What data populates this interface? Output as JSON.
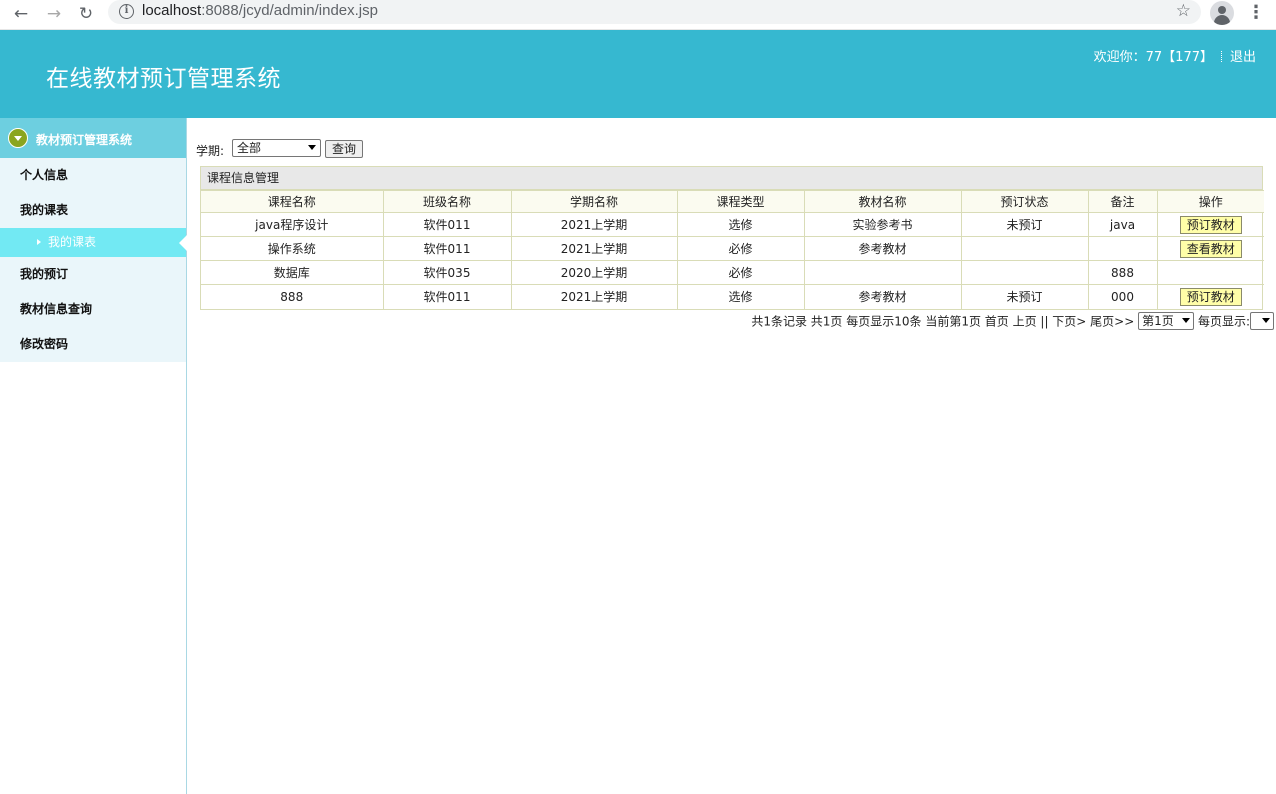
{
  "browser": {
    "url_host": "localhost",
    "url_rest": ":8088/jcyd/admin/index.jsp"
  },
  "header": {
    "title": "在线教材预订管理系统",
    "welcome": "欢迎你：77【177】",
    "logout": "退出"
  },
  "sidebar": {
    "section_title": "教材预订管理系统",
    "items": [
      {
        "label": "个人信息"
      },
      {
        "label": "我的课表"
      }
    ],
    "active_sub": "我的课表",
    "items_after": [
      {
        "label": "我的预订"
      },
      {
        "label": "教材信息查询"
      },
      {
        "label": "修改密码"
      }
    ]
  },
  "filter": {
    "label": "学期:",
    "selected": "全部",
    "query_label": "查询"
  },
  "panel": {
    "title": "课程信息管理",
    "columns": [
      "课程名称",
      "班级名称",
      "学期名称",
      "课程类型",
      "教材名称",
      "预订状态",
      "备注",
      "操作"
    ],
    "rows": [
      [
        "java程序设计",
        "软件011",
        "2021上学期",
        "选修",
        "实验参考书",
        "未预订",
        "java",
        "预订教材"
      ],
      [
        "操作系统",
        "软件011",
        "2021上学期",
        "必修",
        "参考教材",
        "",
        "",
        "查看教材"
      ],
      [
        "数据库",
        "软件035",
        "2020上学期",
        "必修",
        "",
        "",
        "888",
        ""
      ],
      [
        "888",
        "软件011",
        "2021上学期",
        "选修",
        "参考教材",
        "未预订",
        "000",
        "预订教材"
      ]
    ]
  },
  "pager": {
    "text": "共1条记录 共1页 每页显示10条 当前第1页 首页 上页 || 下页> 尾页>>",
    "page_selected": "第1页",
    "per_page_label": "每页显示:"
  }
}
